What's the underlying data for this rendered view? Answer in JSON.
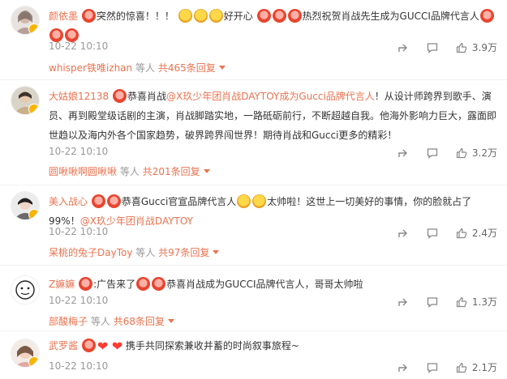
{
  "comments": [
    {
      "user": "颜依墨",
      "text_after_emojis": "突然的惊喜！！！",
      "mid_text": "好开心",
      "tail_text": "热烈祝贺肖战先生成为GUCCI品牌代言人",
      "time": "10-22 10:10",
      "likes": "3.9万",
      "reply_user": "whisper铁唯izhan",
      "reply_mid": "等人",
      "reply_total": "共465条回复"
    },
    {
      "user": "大姑娘12138",
      "text_pre": "恭喜肖战",
      "mention": "@X玖少年团肖战DAYTOY成为Gucci品牌代言人",
      "text_post": "！从设计师跨界到歌手、演员、再到殿堂级话剧的主演，肖战脚踏实地，一路砥砺前行，不断超越自我。他海外影响力巨大，露面即世趋以及海内外各个国家趋势，破界跨界闯世界！期待肖战和Gucci更多的精彩！",
      "time": "10-22 10:10",
      "likes": "3.2万",
      "reply_user": "圆啾啾啊圆啾啾",
      "reply_mid": "等人",
      "reply_total": "共201条回复"
    },
    {
      "user": "美入战心",
      "text_pre": "恭喜Gucci官宣品牌代言人",
      "text_mid": "太帅啦！这世上一切美好的事情，你的脸就占了99%！",
      "mention": "@X玖少年团肖战DAYTOY",
      "time": "10-22 10:10",
      "likes": "2.4万",
      "reply_user": "呆桃的兔子DayToy",
      "reply_mid": "等人",
      "reply_total": "共97条回复"
    },
    {
      "user": "Z嫲嫲",
      "text_pre": ":广告来了",
      "text_post": "恭喜肖战成为GUCCI品牌代言人，哥哥太帅啦",
      "time": "10-22 10:10",
      "likes": "1.3万",
      "reply_user": "部酸梅子",
      "reply_mid": "等人",
      "reply_total": "共68条回复"
    },
    {
      "user": "武罗酱",
      "text_post": "携手共同探索兼收并蓄的时尚叙事旅程~",
      "time": "10-22 10:10",
      "likes": "2.1万"
    }
  ],
  "icons": {
    "share": "share-icon",
    "comment": "comment-icon",
    "like": "like-icon"
  },
  "colors": {
    "username": "#eb7350",
    "meta": "#999999",
    "text": "#333333"
  }
}
